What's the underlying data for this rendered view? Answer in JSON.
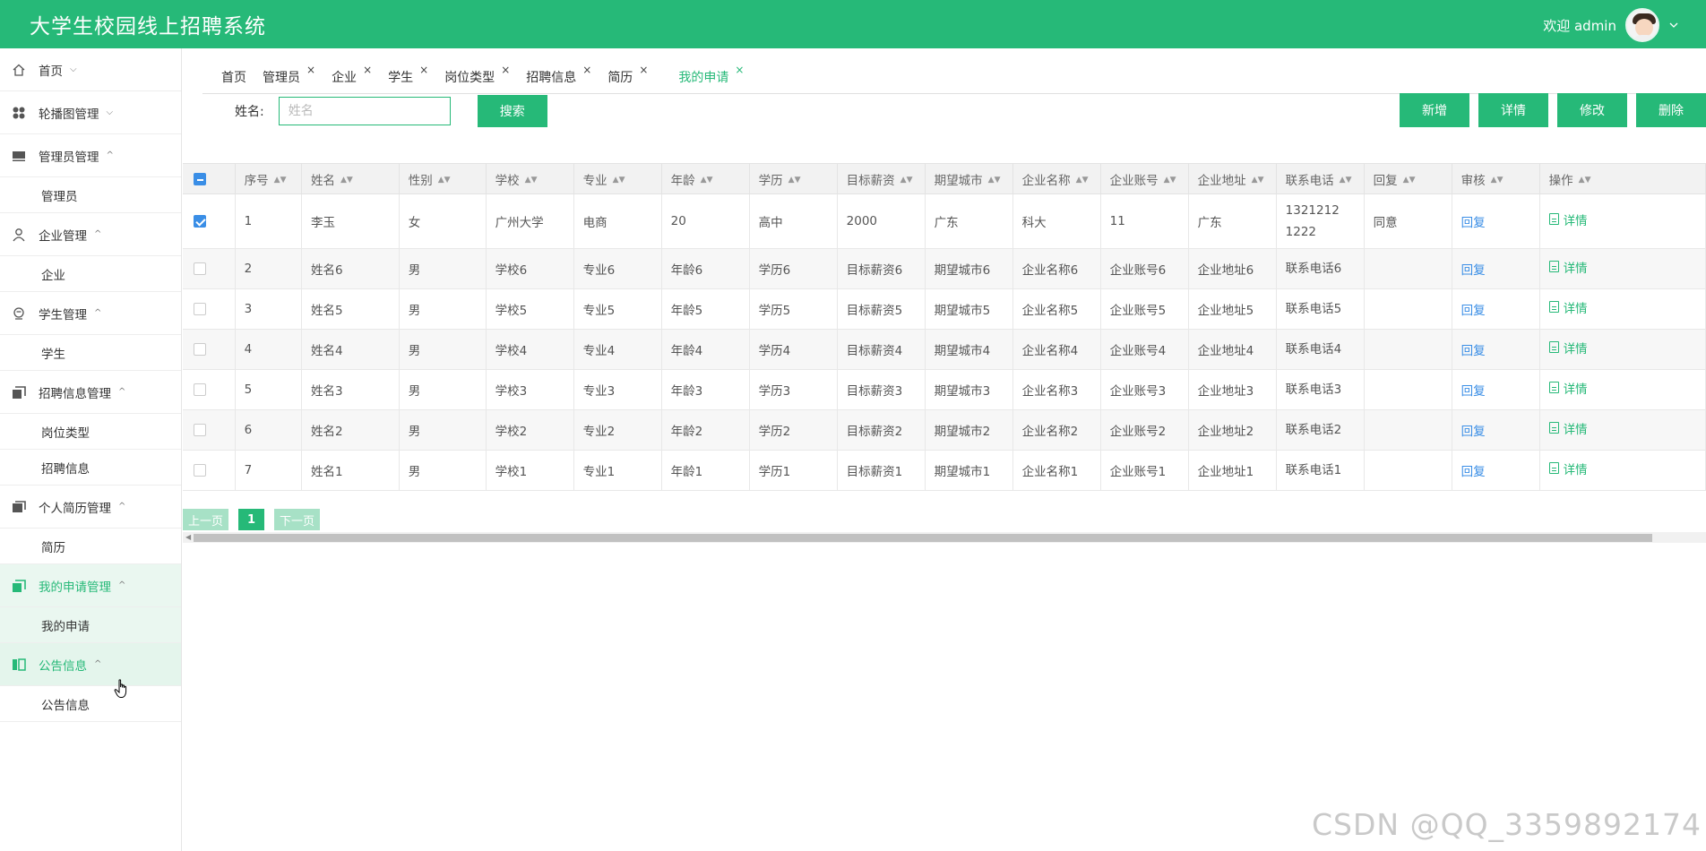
{
  "app": {
    "title": "大学生校园线上招聘系统",
    "welcome": "欢迎 admin"
  },
  "sidebar": {
    "items": [
      {
        "label": "首页",
        "icon": "home-icon",
        "caret": "⌵"
      },
      {
        "label": "轮播图管理",
        "icon": "grid-icon",
        "caret": "⌵"
      },
      {
        "label": "管理员管理",
        "icon": "monitor-icon",
        "caret": "^",
        "children": [
          "管理员"
        ]
      },
      {
        "label": "企业管理",
        "icon": "person-icon",
        "caret": "^",
        "children": [
          "企业"
        ]
      },
      {
        "label": "学生管理",
        "icon": "student-icon",
        "caret": "^",
        "children": [
          "学生"
        ]
      },
      {
        "label": "招聘信息管理",
        "icon": "stack-icon",
        "caret": "^",
        "children": [
          "岗位类型",
          "招聘信息"
        ]
      },
      {
        "label": "个人简历管理",
        "icon": "folder-icon",
        "caret": "^",
        "children": [
          "简历"
        ]
      },
      {
        "label": "我的申请管理",
        "icon": "stack-icon",
        "caret": "^",
        "children": [
          "我的申请"
        ]
      },
      {
        "label": "公告信息",
        "icon": "book-icon",
        "caret": "^",
        "children": [
          "公告信息"
        ]
      }
    ]
  },
  "tabs": [
    {
      "label": "首页"
    },
    {
      "label": "管理员",
      "close": "×"
    },
    {
      "label": "企业",
      "close": "×"
    },
    {
      "label": "学生",
      "close": "×"
    },
    {
      "label": "岗位类型",
      "close": "×"
    },
    {
      "label": "招聘信息",
      "close": "×"
    },
    {
      "label": "简历",
      "close": "×"
    },
    {
      "label": "我的申请",
      "close": "×"
    }
  ],
  "search": {
    "label": "姓名:",
    "placeholder": "姓名",
    "button": "搜索"
  },
  "actions": {
    "add": "新增",
    "detail": "详情",
    "edit": "修改",
    "delete": "删除"
  },
  "table": {
    "sort_glyph": "▲▼",
    "headers": [
      "序号",
      "姓名",
      "性别",
      "学校",
      "专业",
      "年龄",
      "学历",
      "目标薪资",
      "期望城市",
      "企业名称",
      "企业账号",
      "企业地址",
      "联系电话",
      "回复",
      "审核",
      "操作"
    ],
    "rows": [
      {
        "checked": true,
        "cells": [
          "1",
          "李玉",
          "女",
          "广州大学",
          "电商",
          "20",
          "高中",
          "2000",
          "广东",
          "科大",
          "11",
          "广东",
          "13212121222",
          "同意",
          "回复"
        ],
        "op": "详情"
      },
      {
        "checked": false,
        "cells": [
          "2",
          "姓名6",
          "男",
          "学校6",
          "专业6",
          "年龄6",
          "学历6",
          "目标薪资6",
          "期望城市6",
          "企业名称6",
          "企业账号6",
          "企业地址6",
          "联系电话6",
          "",
          "回复"
        ],
        "op": "详情"
      },
      {
        "checked": false,
        "cells": [
          "3",
          "姓名5",
          "男",
          "学校5",
          "专业5",
          "年龄5",
          "学历5",
          "目标薪资5",
          "期望城市5",
          "企业名称5",
          "企业账号5",
          "企业地址5",
          "联系电话5",
          "",
          "回复"
        ],
        "op": "详情"
      },
      {
        "checked": false,
        "cells": [
          "4",
          "姓名4",
          "男",
          "学校4",
          "专业4",
          "年龄4",
          "学历4",
          "目标薪资4",
          "期望城市4",
          "企业名称4",
          "企业账号4",
          "企业地址4",
          "联系电话4",
          "",
          "回复"
        ],
        "op": "详情"
      },
      {
        "checked": false,
        "cells": [
          "5",
          "姓名3",
          "男",
          "学校3",
          "专业3",
          "年龄3",
          "学历3",
          "目标薪资3",
          "期望城市3",
          "企业名称3",
          "企业账号3",
          "企业地址3",
          "联系电话3",
          "",
          "回复"
        ],
        "op": "详情"
      },
      {
        "checked": false,
        "cells": [
          "6",
          "姓名2",
          "男",
          "学校2",
          "专业2",
          "年龄2",
          "学历2",
          "目标薪资2",
          "期望城市2",
          "企业名称2",
          "企业账号2",
          "企业地址2",
          "联系电话2",
          "",
          "回复"
        ],
        "op": "详情"
      },
      {
        "checked": false,
        "cells": [
          "7",
          "姓名1",
          "男",
          "学校1",
          "专业1",
          "年龄1",
          "学历1",
          "目标薪资1",
          "期望城市1",
          "企业名称1",
          "企业账号1",
          "企业地址1",
          "联系电话1",
          "",
          "回复"
        ],
        "op": "详情"
      }
    ]
  },
  "pager": {
    "prev": "上一页",
    "current": "1",
    "next": "下一页"
  },
  "watermark": "CSDN @QQ_3359892174",
  "colors": {
    "accent": "#26b978",
    "link": "#3a8ee6"
  }
}
